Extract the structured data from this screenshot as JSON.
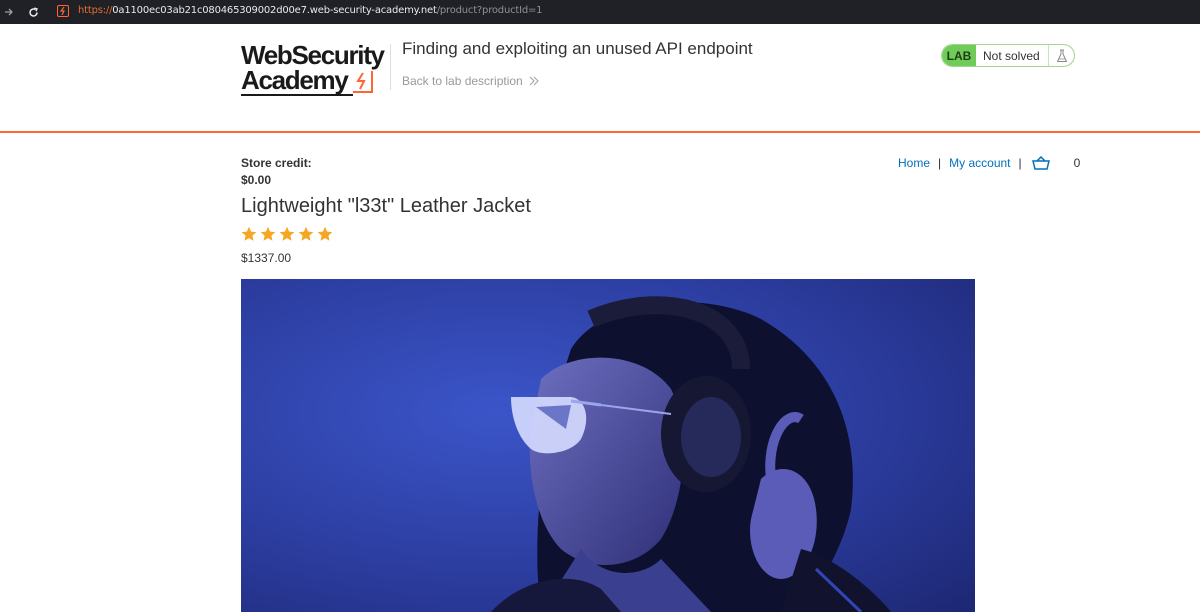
{
  "browser": {
    "url_protocol": "https://",
    "url_host": "0a1100ec03ab21c080465309002d00e7.web-security-academy.net",
    "url_path": "/product?productId=1",
    "icons": [
      "arrow-right-icon",
      "reload-icon",
      "site-favicon-icon"
    ]
  },
  "lab_header": {
    "logo_line1": "WebSecurity",
    "logo_line2": "Academy",
    "title": "Finding and exploiting an unused API endpoint",
    "back_link": "Back to lab description",
    "status_badge": "LAB",
    "status_text": "Not solved"
  },
  "store": {
    "credit_label": "Store credit:",
    "credit_value": "$0.00",
    "nav": {
      "home": "Home",
      "separator": "|",
      "my_account": "My account",
      "cart_count": "0"
    }
  },
  "product": {
    "title": "Lightweight \"l33t\" Leather Jacket",
    "rating": 5,
    "rating_max": 5,
    "price": "$1337.00"
  },
  "colors": {
    "accent": "#ff6633",
    "link": "#0071bc",
    "lab_green": "#70cc58",
    "star": "#f5a623",
    "image_bg": "#2e3f9e"
  }
}
